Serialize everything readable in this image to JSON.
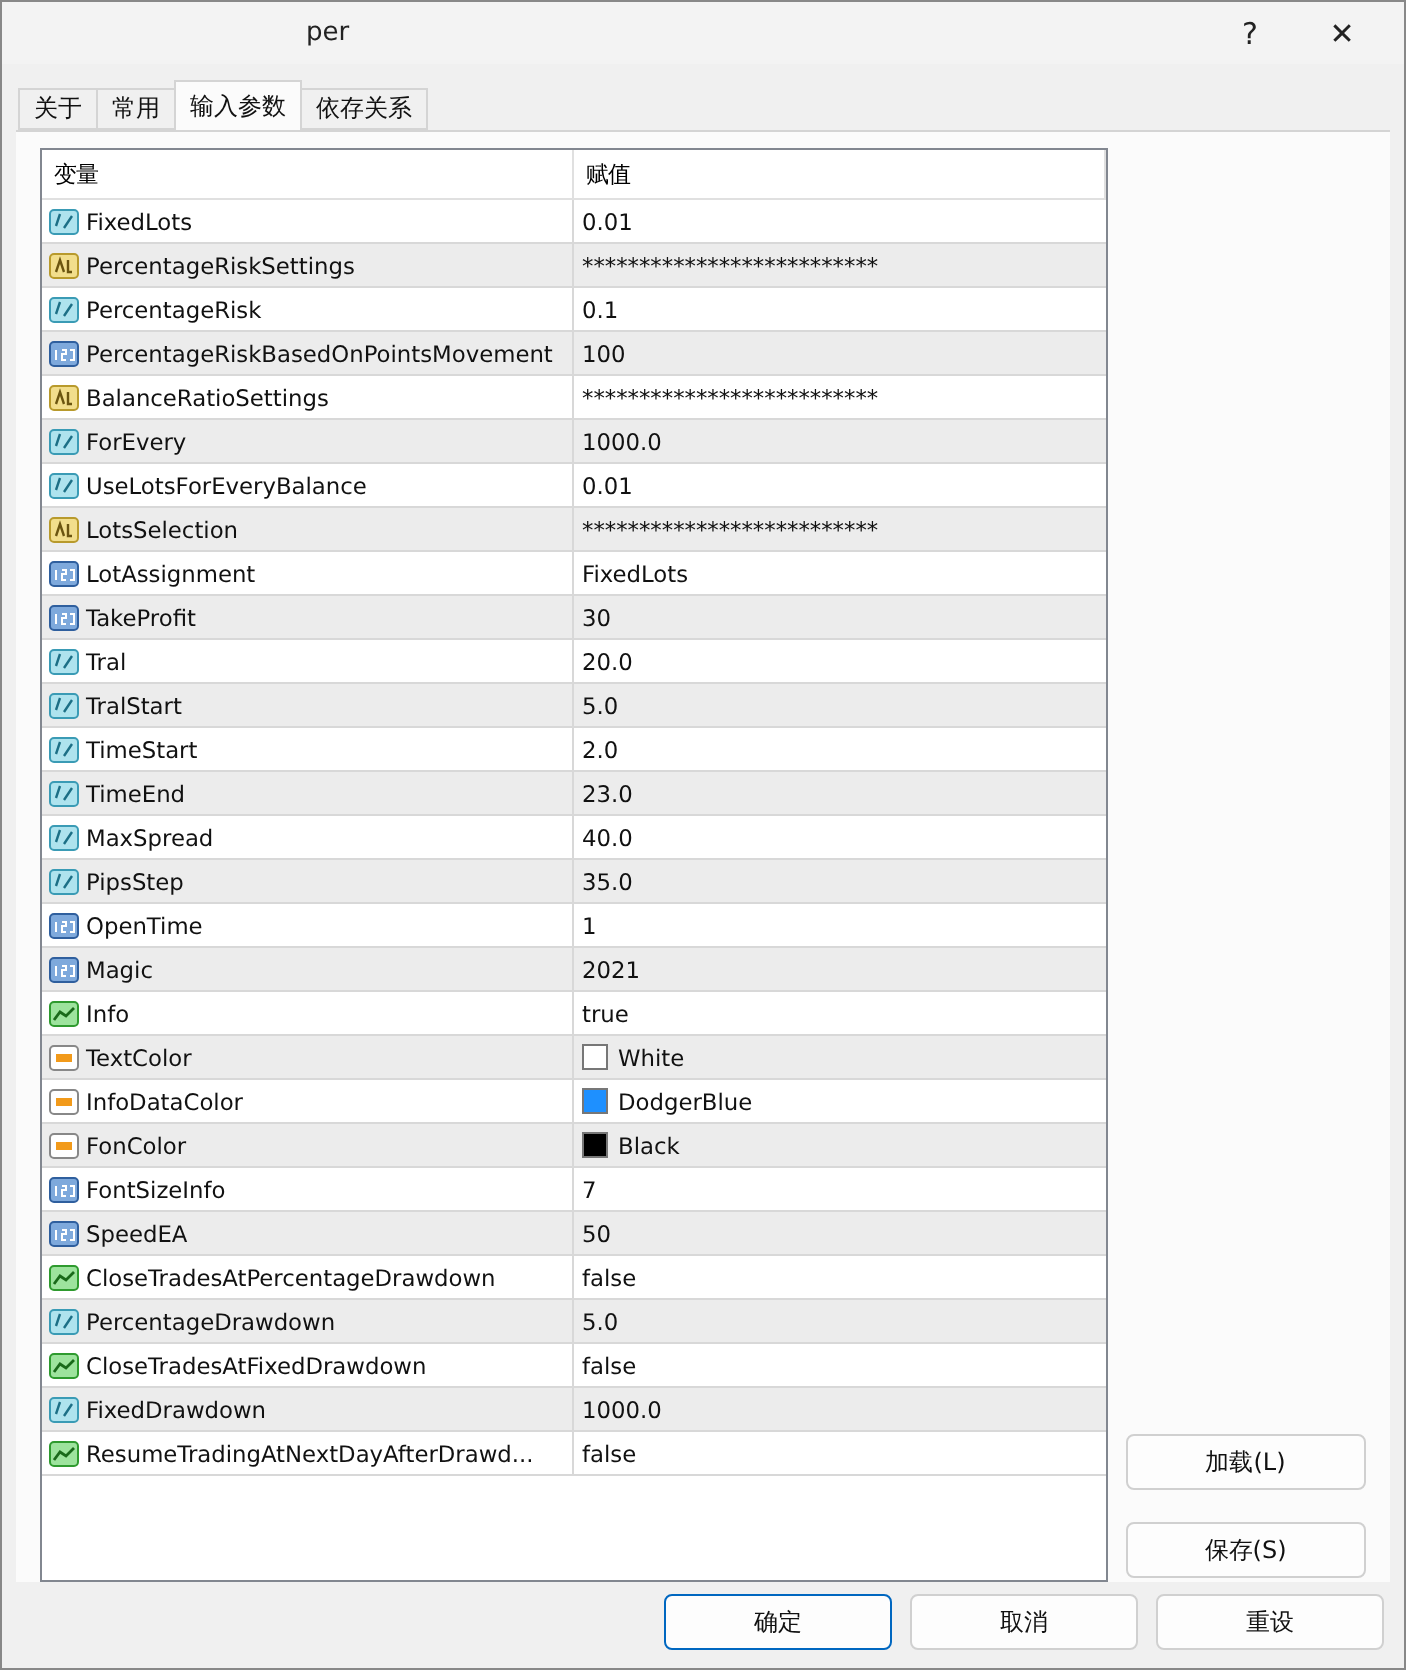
{
  "window": {
    "title": "per",
    "buttons": [
      "?",
      "✕"
    ]
  },
  "tabs": [
    {
      "label": "关于",
      "selected": false
    },
    {
      "label": "常用",
      "selected": false
    },
    {
      "label": "输入参数",
      "selected": true
    },
    {
      "label": "依存关系",
      "selected": false
    }
  ],
  "table": {
    "columns": [
      "变量",
      "赋值"
    ],
    "rows": [
      {
        "kind": "double",
        "name": "FixedLots",
        "value": "0.01"
      },
      {
        "kind": "string",
        "name": "PercentageRiskSettings",
        "value": "**************************"
      },
      {
        "kind": "double",
        "name": "PercentageRisk",
        "value": "0.1"
      },
      {
        "kind": "int",
        "name": "PercentageRiskBasedOnPointsMovement",
        "value": "100"
      },
      {
        "kind": "string",
        "name": "BalanceRatioSettings",
        "value": "**************************"
      },
      {
        "kind": "double",
        "name": "ForEvery",
        "value": "1000.0"
      },
      {
        "kind": "double",
        "name": "UseLotsForEveryBalance",
        "value": "0.01"
      },
      {
        "kind": "string",
        "name": "LotsSelection",
        "value": "**************************"
      },
      {
        "kind": "int",
        "name": "LotAssignment",
        "value": "FixedLots"
      },
      {
        "kind": "int",
        "name": "TakeProfit",
        "value": "30"
      },
      {
        "kind": "double",
        "name": "Tral",
        "value": "20.0"
      },
      {
        "kind": "double",
        "name": "TralStart",
        "value": "5.0"
      },
      {
        "kind": "double",
        "name": "TimeStart",
        "value": "2.0"
      },
      {
        "kind": "double",
        "name": "TimeEnd",
        "value": "23.0"
      },
      {
        "kind": "double",
        "name": "MaxSpread",
        "value": "40.0"
      },
      {
        "kind": "double",
        "name": "PipsStep",
        "value": "35.0"
      },
      {
        "kind": "int",
        "name": "OpenTime",
        "value": "1"
      },
      {
        "kind": "int",
        "name": "Magic",
        "value": "2021"
      },
      {
        "kind": "bool",
        "name": "Info",
        "value": "true"
      },
      {
        "kind": "color",
        "name": "TextColor",
        "value": "White",
        "color": "#ffffff"
      },
      {
        "kind": "color",
        "name": "InfoDataColor",
        "value": "DodgerBlue",
        "color": "#1e90ff"
      },
      {
        "kind": "color",
        "name": "FonColor",
        "value": "Black",
        "color": "#000000"
      },
      {
        "kind": "int",
        "name": "FontSizeInfo",
        "value": "7"
      },
      {
        "kind": "int",
        "name": "SpeedEA",
        "value": "50"
      },
      {
        "kind": "bool",
        "name": "CloseTradesAtPercentageDrawdown",
        "value": "false"
      },
      {
        "kind": "double",
        "name": "PercentageDrawdown",
        "value": "5.0"
      },
      {
        "kind": "bool",
        "name": "CloseTradesAtFixedDrawdown",
        "value": "false"
      },
      {
        "kind": "double",
        "name": "FixedDrawdown",
        "value": "1000.0"
      },
      {
        "kind": "bool",
        "name": "ResumeTradingAtNextDayAfterDrawd...",
        "value": "false"
      }
    ]
  },
  "side_buttons": [
    "加载(L)",
    "保存(S)"
  ],
  "footer_buttons": [
    {
      "label": "确定",
      "default": true
    },
    {
      "label": "取消",
      "default": false
    },
    {
      "label": "重设",
      "default": false
    }
  ]
}
